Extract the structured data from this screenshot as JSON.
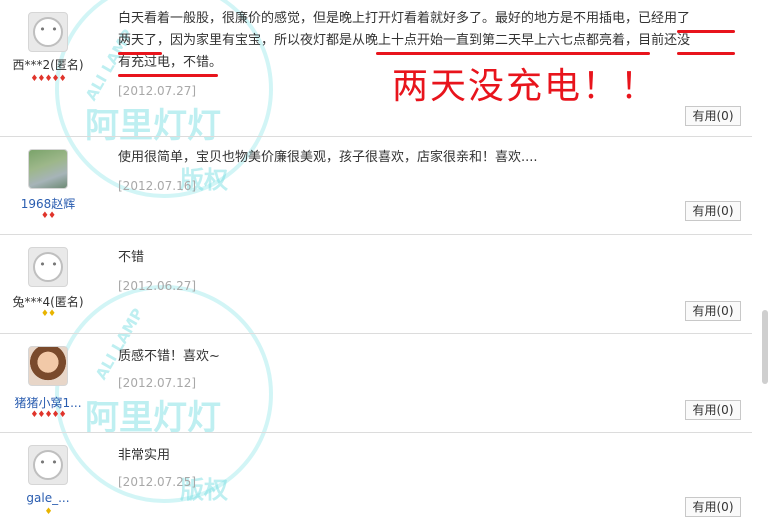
{
  "reviews": [
    {
      "username": "西***2(匿名)",
      "rank_icons": "♦♦♦♦♦",
      "content_line1_a": "白天看着一般股，很廉价的感觉，但是晚上打开灯看着就好多了。最好的地方是不用插电，",
      "content_line1_b": "已经用了",
      "content_line2_a": "两天了",
      "content_line2_b": "，因为家里有宝宝，所以夜灯都是",
      "content_line2_c": "从晚上十点开始一直到第二天早上六七点都亮着",
      "content_line2_d": "，",
      "content_line2_e": "目前还没",
      "content_line3_a": "有充过电，不错",
      "content_line3_b": "。",
      "date": "[2012.07.27]",
      "useful": "有用(0)"
    },
    {
      "username": "1968赵辉",
      "rank_icons": "♦♦",
      "content": "使用很简单，宝贝也物美价廉很美观，孩子很喜欢，店家很亲和！喜欢....",
      "date": "[2012.07.16]",
      "useful": "有用(0)"
    },
    {
      "username": "兔***4(匿名)",
      "rank_icons": "♦♦",
      "content": "不错",
      "date": "[2012.06.27]",
      "useful": "有用(0)"
    },
    {
      "username": "猪猪小窝1...",
      "rank_icons": "♦♦♦♦♦",
      "content": "质感不错！喜欢~",
      "date": "[2012.07.12]",
      "useful": "有用(0)"
    },
    {
      "username": "gale_...",
      "rank_icons": "♦",
      "content": "非常实用",
      "date": "[2012.07.25]",
      "useful": "有用(0)"
    }
  ],
  "annotation": "两天没充电！！",
  "watermark": {
    "title": "阿里灯灯",
    "subtitle": "版权",
    "ring": "ALI LAMP"
  },
  "colors": {
    "annotation_red": "#e8141c",
    "watermark_cyan": "#6edce1",
    "username_blue": "#2a5db0",
    "date_gray": "#a8a8a8"
  }
}
